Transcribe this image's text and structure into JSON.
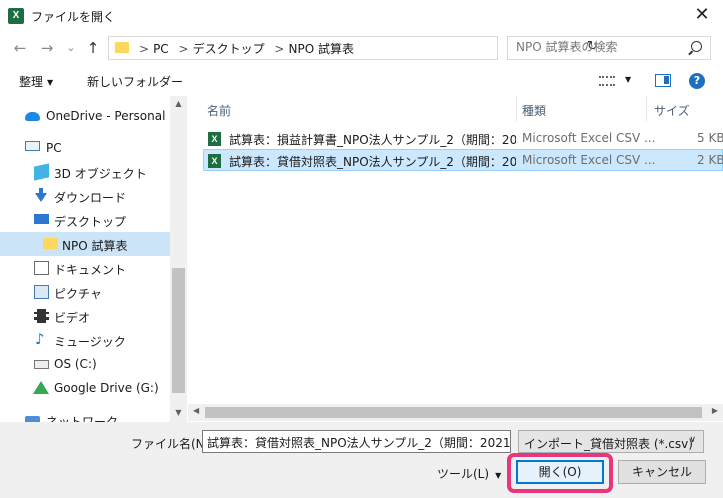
{
  "window": {
    "app_icon": "excel-icon",
    "title": "ファイルを開く",
    "close_label": "✕"
  },
  "nav": {
    "back": "←",
    "forward": "→",
    "recent": "⌄",
    "up": "↑"
  },
  "address": {
    "crumbs": [
      "PC",
      "デスクトップ",
      "NPO 試算表"
    ],
    "separator": ">",
    "dropdown": "⌄",
    "refresh": "↻"
  },
  "search": {
    "placeholder": "NPO 試算表の検索"
  },
  "toolbar": {
    "organize": "整理",
    "new_folder": "新しいフォルダー",
    "caret": "▼"
  },
  "sidebar": {
    "items": [
      {
        "label": "OneDrive - Personal",
        "icon": "cloud-icon"
      },
      {
        "label": "PC",
        "icon": "pc-icon"
      },
      {
        "label": "3D オブジェクト",
        "icon": "3d-objects-icon"
      },
      {
        "label": "ダウンロード",
        "icon": "download-icon"
      },
      {
        "label": "デスクトップ",
        "icon": "desktop-icon"
      },
      {
        "label": "NPO 試算表",
        "icon": "folder-icon",
        "selected": true
      },
      {
        "label": "ドキュメント",
        "icon": "documents-icon"
      },
      {
        "label": "ピクチャ",
        "icon": "pictures-icon"
      },
      {
        "label": "ビデオ",
        "icon": "videos-icon"
      },
      {
        "label": "ミュージック",
        "icon": "music-icon"
      },
      {
        "label": "OS (C:)",
        "icon": "drive-icon"
      },
      {
        "label": "Google Drive (G:)",
        "icon": "google-drive-icon"
      },
      {
        "label": "ネットワーク",
        "icon": "network-icon"
      }
    ]
  },
  "columns": {
    "name": "名前",
    "type": "種類",
    "size": "サイズ"
  },
  "files": [
    {
      "name": "試算表：損益計算書_NPO法人サンプル_2（期間：20...",
      "type": "Microsoft Excel CSV ...",
      "size": "5 KB",
      "selected": false
    },
    {
      "name": "試算表：貸借対照表_NPO法人サンプル_2（期間：20...",
      "type": "Microsoft Excel CSV ...",
      "size": "2 KB",
      "selected": true
    }
  ],
  "bottom": {
    "filename_label": "ファイル名(N):",
    "filename_value": "試算表：貸借対照表_NPO法人サンプル_2（期間：2021",
    "filter": "インポート_貸借対照表 (*.csv)",
    "tools": "ツール(L)",
    "open": "開く(O)",
    "cancel": "キャンセル"
  },
  "colors": {
    "accent": "#0078d7",
    "highlight": "#e8357b",
    "selection": "#cce8ff",
    "excel": "#1d6f42"
  }
}
